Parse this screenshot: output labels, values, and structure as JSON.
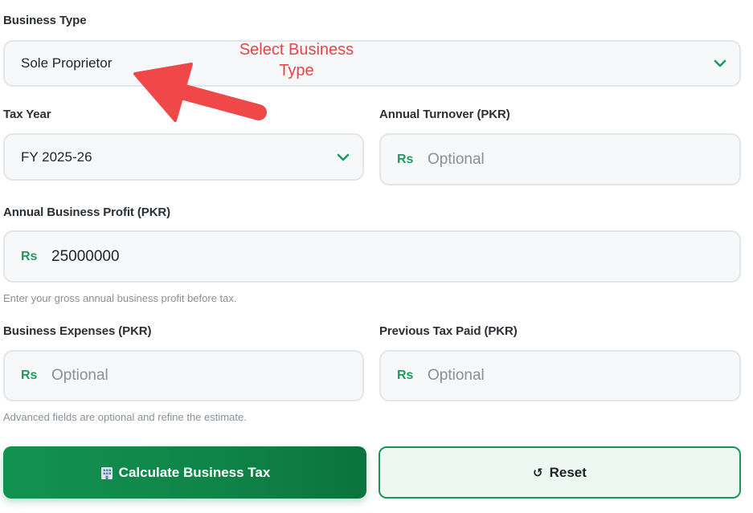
{
  "business_type": {
    "label": "Business Type",
    "value": "Sole Proprietor",
    "icon": "chevron-down-icon"
  },
  "tax_year": {
    "label": "Tax Year",
    "value": "FY 2025-26",
    "icon": "chevron-down-icon"
  },
  "annual_turnover": {
    "label": "Annual Turnover (PKR)",
    "prefix": "Rs",
    "placeholder": "Optional",
    "value": ""
  },
  "annual_profit": {
    "label": "Annual Business Profit (PKR)",
    "prefix": "Rs",
    "value": "25000000",
    "help": "Enter your gross annual business profit before tax."
  },
  "business_expenses": {
    "label": "Business Expenses (PKR)",
    "prefix": "Rs",
    "placeholder": "Optional",
    "value": ""
  },
  "previous_tax": {
    "label": "Previous Tax Paid (PKR)",
    "prefix": "Rs",
    "placeholder": "Optional",
    "value": ""
  },
  "advanced_note": "Advanced fields are optional and refine the estimate.",
  "buttons": {
    "calculate_label": "Calculate Business Tax",
    "calculate_icon": "building-icon",
    "reset_label": "Reset",
    "reset_icon": "reset-icon"
  },
  "annotation": {
    "line1": "Select Business",
    "line2": "Type"
  },
  "colors": {
    "accent": "#1f9a5c",
    "primary_button": "#0f8448",
    "annotation": "#e64545"
  }
}
